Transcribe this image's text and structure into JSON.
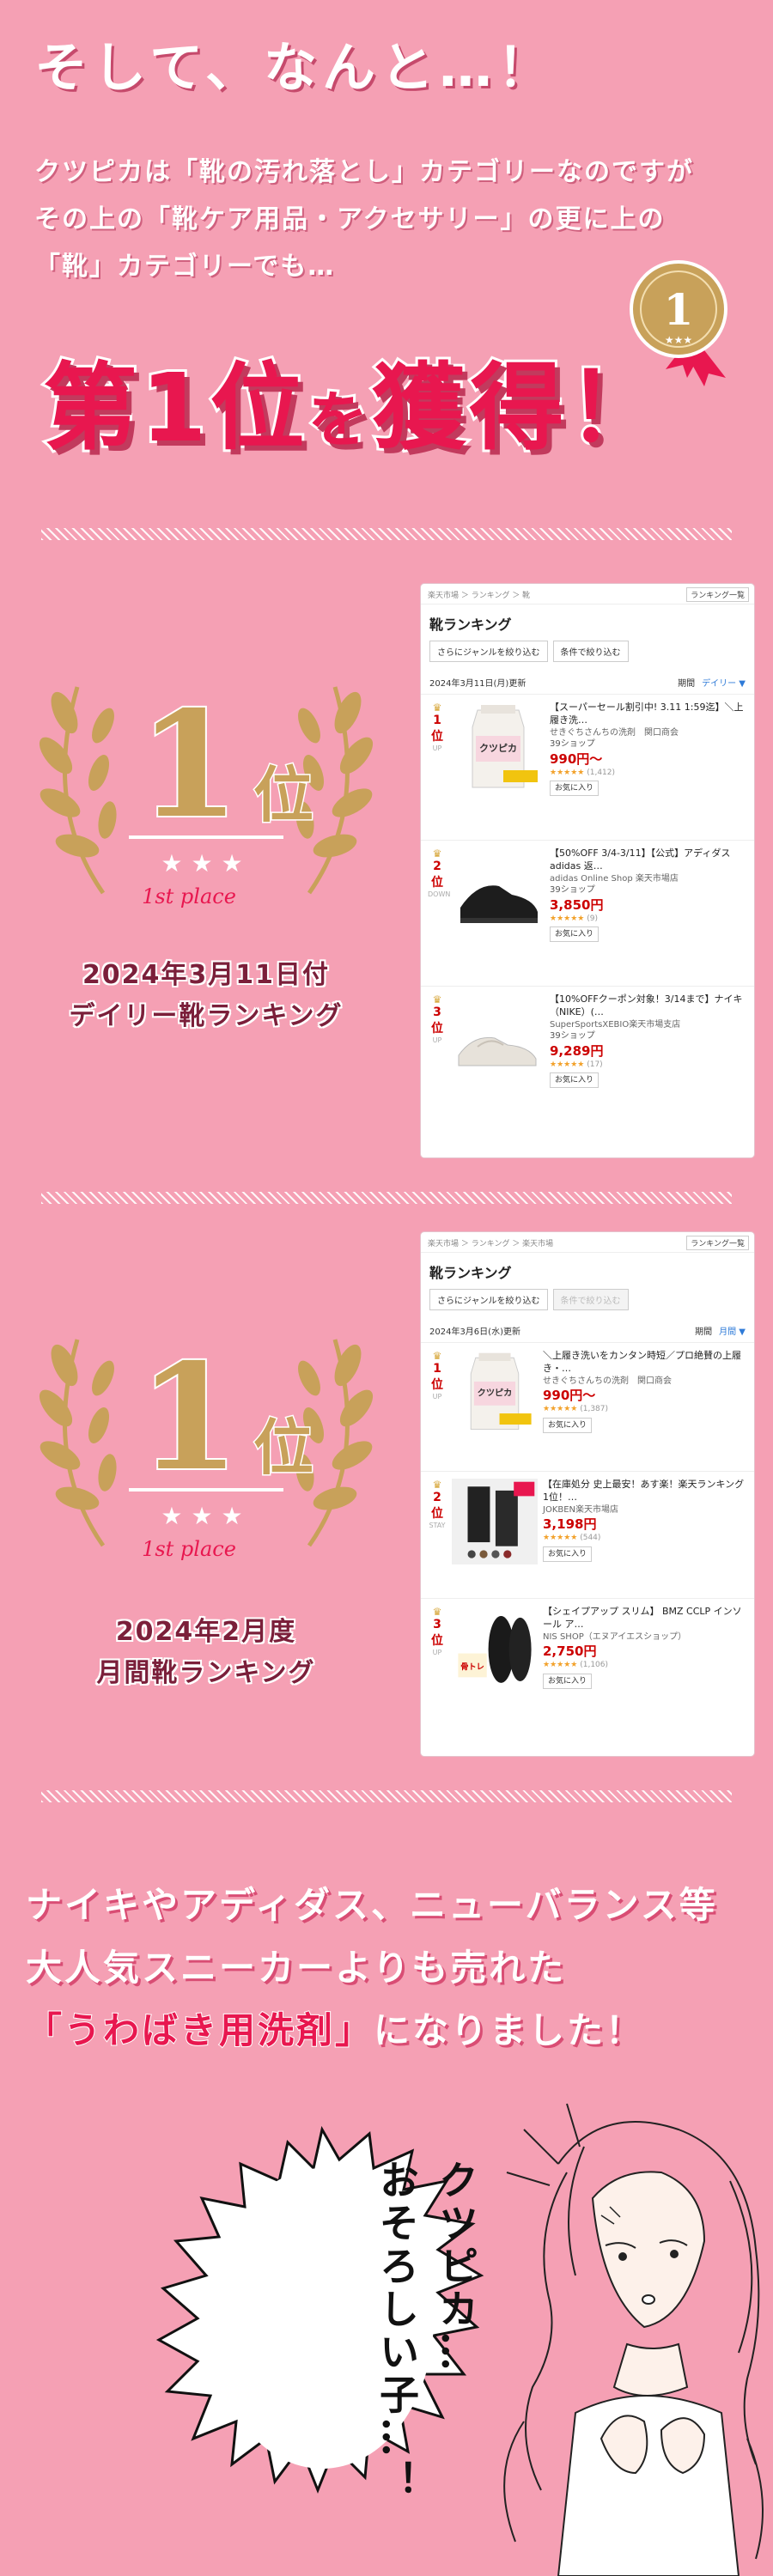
{
  "header": {
    "headline": "そして、なんと…！",
    "intro": [
      "クツピカは「靴の汚れ落とし」カテゴリーなのですが",
      "その上の「靴ケア用品・アクセサリー」の更に上の",
      "「靴」カテゴリーでも…"
    ],
    "big_title_a": "第",
    "big_title_b": "1位",
    "big_title_c": "を",
    "big_title_d": "獲得！",
    "badge_number": "1"
  },
  "award1": {
    "rank_number": "1",
    "rank_unit": "位",
    "sub": "1st place",
    "caption_line1": "2024年3月11日付",
    "caption_line2": "デイリー靴ランキング"
  },
  "award2": {
    "rank_number": "1",
    "rank_unit": "位",
    "sub": "1st place",
    "caption_line1": "2024年2月度",
    "caption_line2": "月間靴ランキング"
  },
  "panel1": {
    "crumb": "楽天市場 ＞ ランキング ＞ 靴",
    "crumb_btn": "ランキング一覧",
    "title": "靴ランキング",
    "filter1": "さらにジャンルを絞り込む",
    "filter2": "条件で絞り込む",
    "date": "2024年3月11日(月)更新",
    "period_label": "期間",
    "period_value": "デイリー ▼",
    "items": [
      {
        "rank": "1位",
        "move": "UP",
        "title": "【スーパーセール割引中! 3.11 1:59迄】＼上履き洗…",
        "shop": "せきぐちさんちの洗剤　関口商会",
        "tag": "39ショップ",
        "price": "990円〜",
        "stars": "★★★★★",
        "reviews": "(1,412)",
        "fav": "お気に入り"
      },
      {
        "rank": "2位",
        "move": "DOWN",
        "title": "【50%OFF 3/4-3/11】【公式】アディダス adidas 返…",
        "shop": "adidas Online Shop 楽天市場店",
        "tag": "39ショップ",
        "price": "3,850円",
        "stars": "★★★★★",
        "reviews": "(9)",
        "fav": "お気に入り"
      },
      {
        "rank": "3位",
        "move": "UP",
        "title": "【10%OFFクーポン対象！3/14まで】ナイキ（NIKE）(…",
        "shop": "SuperSportsXEBIO楽天市場支店",
        "tag": "39ショップ",
        "price": "9,289円",
        "stars": "★★★★★",
        "reviews": "(17)",
        "fav": "お気に入り"
      }
    ]
  },
  "panel2": {
    "crumb": "楽天市場 ＞ ランキング ＞ 楽天市場",
    "crumb_btn": "ランキング一覧",
    "title": "靴ランキング",
    "filter1": "さらにジャンルを絞り込む",
    "filter2": "条件で絞り込む",
    "date": "2024年3月6日(水)更新",
    "period_label": "期間",
    "period_value": "月間 ▼",
    "items": [
      {
        "rank": "1位",
        "move": "UP",
        "title": "＼上履き洗いをカンタン時短／プロ絶賛の上履き・…",
        "shop": "せきぐちさんちの洗剤　関口商会",
        "tag": "",
        "price": "990円〜",
        "stars": "★★★★★",
        "reviews": "(1,387)",
        "fav": "お気に入り"
      },
      {
        "rank": "2位",
        "move": "STAY",
        "title": "【在庫処分 史上最安！あす楽！楽天ランキング1位！…",
        "shop": "JOKBEN楽天市場店",
        "tag": "",
        "price": "3,198円",
        "stars": "★★★★★",
        "reviews": "(544)",
        "fav": "お気に入り"
      },
      {
        "rank": "3位",
        "move": "UP",
        "title": "【シェイプアップ スリム】 BMZ CCLP インソール ア…",
        "shop": "NIS SHOP（エヌアイエスショップ）",
        "tag": "",
        "price": "2,750円",
        "stars": "★★★★★",
        "reviews": "(1,106)",
        "fav": "お気に入り"
      }
    ]
  },
  "message": {
    "line1": "ナイキやアディダス、ニューバランス等",
    "line2": "大人気スニーカーよりも売れた",
    "line3_em": "「うわばき用洗剤」",
    "line3_rest": "になりました！"
  },
  "speech": {
    "line1": "クツピカ…",
    "line2": "おそろしい子…！"
  },
  "colors": {
    "background": "#f5a0b4",
    "title_red": "#e8174f",
    "gold": "#c8a15a"
  }
}
